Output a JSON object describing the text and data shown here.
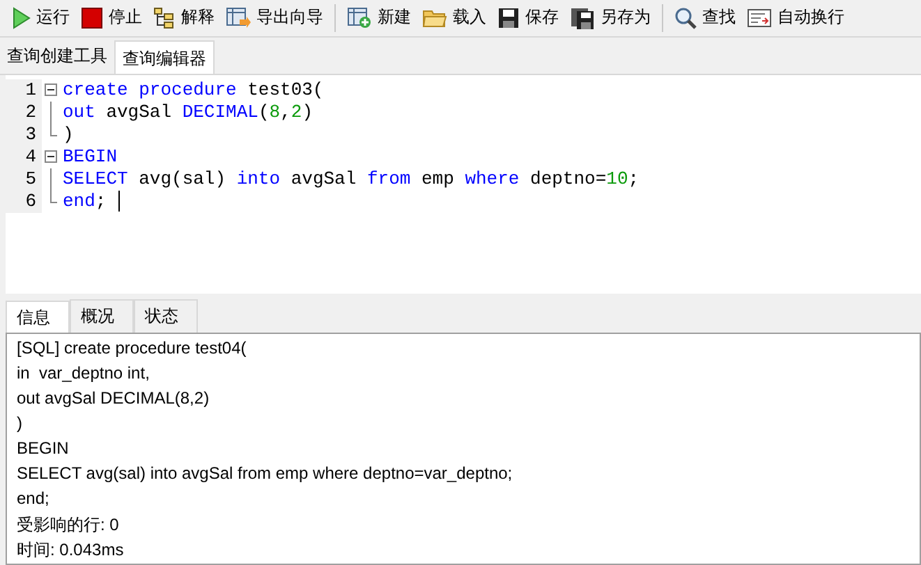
{
  "toolbar": {
    "groups": [
      [
        {
          "kind": "run",
          "label": "运行"
        },
        {
          "kind": "stop",
          "label": "停止"
        },
        {
          "kind": "explain",
          "label": "解释"
        },
        {
          "kind": "export",
          "label": "导出向导"
        }
      ],
      [
        {
          "kind": "new",
          "label": "新建"
        },
        {
          "kind": "load",
          "label": "载入"
        },
        {
          "kind": "save",
          "label": "保存"
        },
        {
          "kind": "saveas",
          "label": "另存为"
        }
      ],
      [
        {
          "kind": "find",
          "label": "查找"
        },
        {
          "kind": "wrap",
          "label": "自动换行"
        }
      ]
    ]
  },
  "editor_tabs": [
    {
      "label": "查询创建工具",
      "selected": false
    },
    {
      "label": "查询编辑器",
      "selected": true
    }
  ],
  "editor": {
    "lines": [
      {
        "number": "1",
        "kind": "fold-start",
        "tokens": [
          {
            "kind": "keyword",
            "text": "create procedure"
          },
          {
            "kind": "plain",
            "text": " test03("
          }
        ]
      },
      {
        "number": "2",
        "kind": "fold-mid",
        "tokens": [
          {
            "kind": "keyword",
            "text": "out"
          },
          {
            "kind": "plain",
            "text": " avgSal "
          },
          {
            "kind": "keyword",
            "text": "DECIMAL"
          },
          {
            "kind": "plain",
            "text": "("
          },
          {
            "kind": "number",
            "text": "8"
          },
          {
            "kind": "plain",
            "text": ","
          },
          {
            "kind": "number",
            "text": "2"
          },
          {
            "kind": "plain",
            "text": ")"
          }
        ]
      },
      {
        "number": "3",
        "kind": "fold-end",
        "tokens": [
          {
            "kind": "plain",
            "text": ")"
          }
        ]
      },
      {
        "number": "4",
        "kind": "fold-start",
        "tokens": [
          {
            "kind": "keyword",
            "text": "BEGIN"
          }
        ]
      },
      {
        "number": "5",
        "kind": "fold-mid",
        "tokens": [
          {
            "kind": "keyword",
            "text": "SELECT"
          },
          {
            "kind": "plain",
            "text": " avg(sal) "
          },
          {
            "kind": "keyword",
            "text": "into"
          },
          {
            "kind": "plain",
            "text": " avgSal "
          },
          {
            "kind": "keyword",
            "text": "from"
          },
          {
            "kind": "plain",
            "text": " emp "
          },
          {
            "kind": "keyword",
            "text": "where"
          },
          {
            "kind": "plain",
            "text": " deptno="
          },
          {
            "kind": "number",
            "text": "10"
          },
          {
            "kind": "plain",
            "text": ";"
          }
        ]
      },
      {
        "number": "6",
        "kind": "fold-end",
        "cursor": true,
        "tokens": [
          {
            "kind": "keyword",
            "text": "end"
          },
          {
            "kind": "plain",
            "text": ";"
          }
        ]
      }
    ]
  },
  "result_tabs": [
    {
      "label": "信息",
      "selected": true
    },
    {
      "label": "概况",
      "selected": false
    },
    {
      "label": "状态",
      "selected": false
    }
  ],
  "messages": [
    "[SQL] create procedure test04(",
    "in  var_deptno int,",
    "out avgSal DECIMAL(8,2)",
    ")",
    "BEGIN",
    "SELECT avg(sal) into avgSal from emp where deptno=var_deptno;",
    "end;",
    "受影响的行: 0",
    "时间: 0.043ms"
  ]
}
